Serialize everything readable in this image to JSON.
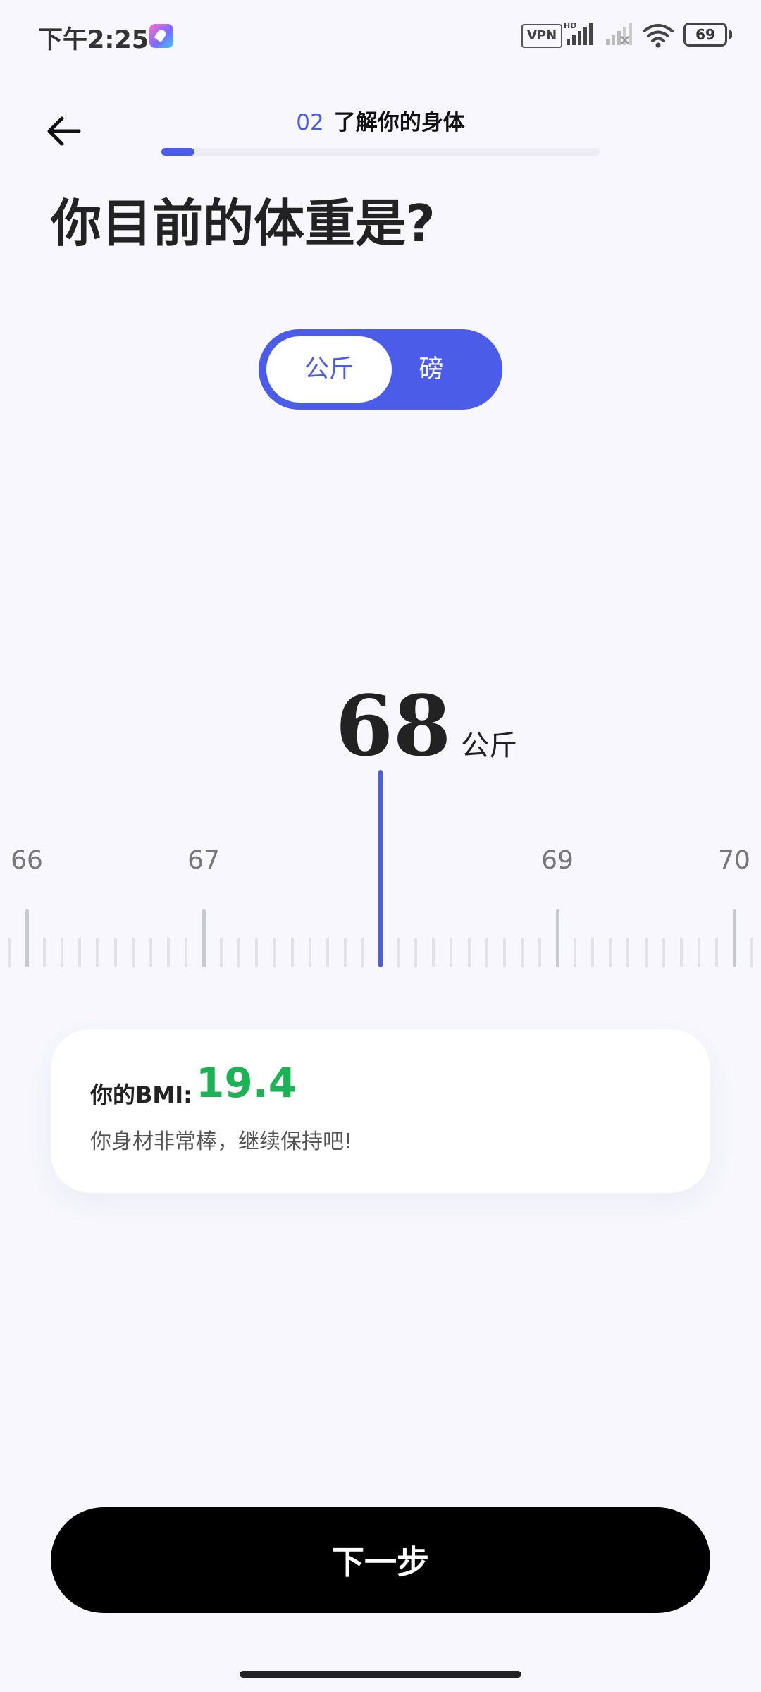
{
  "status_bar": {
    "time": "下午2:25",
    "vpn_label": "VPN",
    "network_label": "HD",
    "battery_level": "69",
    "icons": [
      "app-rocket-icon",
      "signal-icon",
      "wifi-icon",
      "battery-icon"
    ]
  },
  "header": {
    "back_icon": "arrow-left-icon",
    "step_number": "02",
    "step_title": "了解你的身体",
    "progress_fraction": 0.075
  },
  "page": {
    "title": "你目前的体重是?"
  },
  "unit_toggle": {
    "options": [
      {
        "label": "公斤",
        "selected": true
      },
      {
        "label": "磅",
        "selected": false
      }
    ]
  },
  "weight": {
    "value": "68",
    "unit": "公斤"
  },
  "ruler": {
    "labels": [
      "66",
      "67",
      "69",
      "70"
    ],
    "selected_value": 68
  },
  "bmi_card": {
    "label": "你的BMI:",
    "value": "19.4",
    "message": "你身材非常棒，继续保持吧!"
  },
  "footer": {
    "next_label": "下一步"
  },
  "colors": {
    "accent": "#4b5ce8",
    "bmi_good": "#1cb356",
    "background": "#f7f7fd",
    "button": "#000000"
  }
}
